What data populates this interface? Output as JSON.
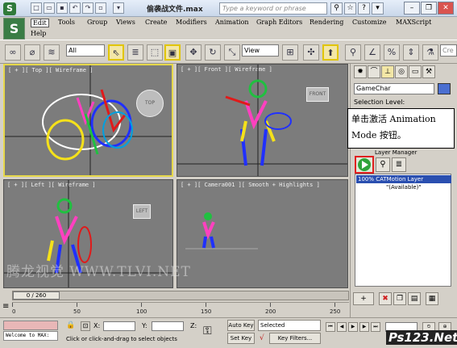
{
  "titlebar": {
    "title": "偷袭战文件.max",
    "search_placeholder": "Type a keyword or phrase",
    "quick_icons": [
      "new-icon",
      "open-icon",
      "save-icon",
      "undo-icon",
      "redo-icon",
      "hold-icon"
    ]
  },
  "menu": {
    "items": [
      "Edit",
      "Tools",
      "Group",
      "Views",
      "Create",
      "Modifiers",
      "Animation",
      "Graph Editors",
      "Rendering",
      "Customize",
      "MAXScript",
      "Help"
    ]
  },
  "toolbar": {
    "selection_filter": "All",
    "ref_coord": "View",
    "search_snippet": "Cre"
  },
  "viewports": [
    {
      "label": "[ + ][ Top ][ Wireframe ]",
      "cube": "TOP"
    },
    {
      "label": "[ + ][ Front ][ Wireframe ]",
      "cube": "FRONT"
    },
    {
      "label": "[ + ][ Left ][ Wireframe ]",
      "cube": "LEFT"
    },
    {
      "label": "[ + ][ Camera001 ][ Smooth + Highlights ]",
      "cube": ""
    }
  ],
  "command_panel": {
    "object_name": "GameChar",
    "object_color": "#4a6fd1",
    "selection_level": "Selection Level:",
    "layer_header": "Layer Manager",
    "layers": [
      {
        "name": "100% CATMotion Layer"
      },
      {
        "name": "\"(Available)\""
      }
    ],
    "callout": "单击激活 Animation Mode 按钮。"
  },
  "timeline": {
    "frame": "0 / 260",
    "ticks": [
      "0",
      "50",
      "100",
      "150",
      "200",
      "250"
    ]
  },
  "status": {
    "welcome": "Welcome to MAX:",
    "prompt": "Click or click-and-drag to select objects",
    "x_label": "X:",
    "y_label": "Y:",
    "z_label": "Z:",
    "auto_key": "Auto Key",
    "set_key": "Set Key",
    "selected": "Selected",
    "key_filters": "Key Filters..."
  },
  "watermarks": {
    "tlvi": "腾龙视觉 WWW.TLVI.NET",
    "ps123": "Ps123.Net"
  }
}
